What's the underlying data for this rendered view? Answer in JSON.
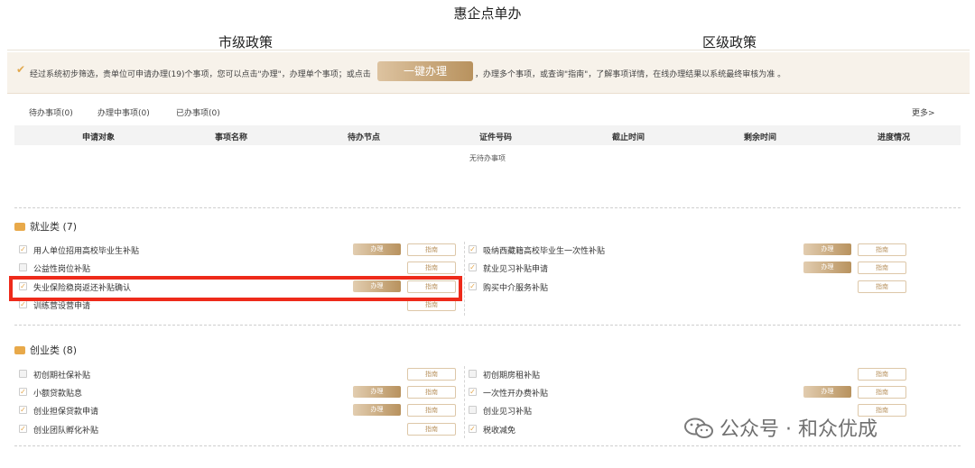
{
  "page_title": "惠企点单办",
  "tabs": [
    {
      "label": "市级政策",
      "active": true
    },
    {
      "label": "区级政策",
      "active": false
    }
  ],
  "notice": {
    "text_before": "经过系统初步筛选，贵单位可申请办理(19)个事项，您可以点击\"办理\"，办理单个事项；或点击",
    "button_label": "一键办理",
    "text_after": "，办理多个事项，或查询\"指南\"，了解事项详情，在线办理结果以系统最终审核为准 。"
  },
  "subtabs": [
    "待办事项(0)",
    "办理中事项(0)",
    "已办事项(0)"
  ],
  "more_label": "更多>",
  "table": {
    "columns": [
      "申请对象",
      "事项名称",
      "待办节点",
      "证件号码",
      "截止时间",
      "剩余时间",
      "进度情况"
    ],
    "empty_text": "无待办事项"
  },
  "categories": [
    {
      "title": "就业类 (7)",
      "left": [
        {
          "label": "用人单位招用高校毕业生补贴",
          "checked": true,
          "do": "办理",
          "guide": "指南"
        },
        {
          "label": "公益性岗位补贴",
          "checked": false,
          "do": null,
          "guide": "指南"
        },
        {
          "label": "失业保险稳岗返还补贴确认",
          "checked": true,
          "do": "办理",
          "guide": "指南"
        },
        {
          "label": "训练营设营申请",
          "checked": true,
          "do": null,
          "guide": "指南"
        }
      ],
      "right": [
        {
          "label": "吸纳西藏籍高校毕业生一次性补贴",
          "checked": true,
          "do": "办理",
          "guide": "指南"
        },
        {
          "label": "就业见习补贴申请",
          "checked": true,
          "do": "办理",
          "guide": "指南"
        },
        {
          "label": "购买中介服务补贴",
          "checked": true,
          "do": null,
          "guide": "指南"
        }
      ]
    },
    {
      "title": "创业类 (8)",
      "left": [
        {
          "label": "初创期社保补贴",
          "checked": false,
          "do": null,
          "guide": "指南"
        },
        {
          "label": "小额贷款贴息",
          "checked": true,
          "do": "办理",
          "guide": "指南"
        },
        {
          "label": "创业担保贷款申请",
          "checked": true,
          "do": "办理",
          "guide": "指南"
        },
        {
          "label": "创业团队孵化补贴",
          "checked": true,
          "do": null,
          "guide": "指南"
        }
      ],
      "right": [
        {
          "label": "初创期房租补贴",
          "checked": false,
          "do": null,
          "guide": "指南"
        },
        {
          "label": "一次性开办费补贴",
          "checked": true,
          "do": "办理",
          "guide": "指南"
        },
        {
          "label": "创业见习补贴",
          "checked": false,
          "do": null,
          "guide": "指南"
        },
        {
          "label": "税收减免",
          "checked": true,
          "do": null,
          "guide": null
        }
      ]
    }
  ],
  "watermark": "公众号 · 和众优成",
  "colors": {
    "accent": "#b8925e",
    "highlight": "#ee2a1a",
    "notice_bg": "#f7f2ea"
  }
}
